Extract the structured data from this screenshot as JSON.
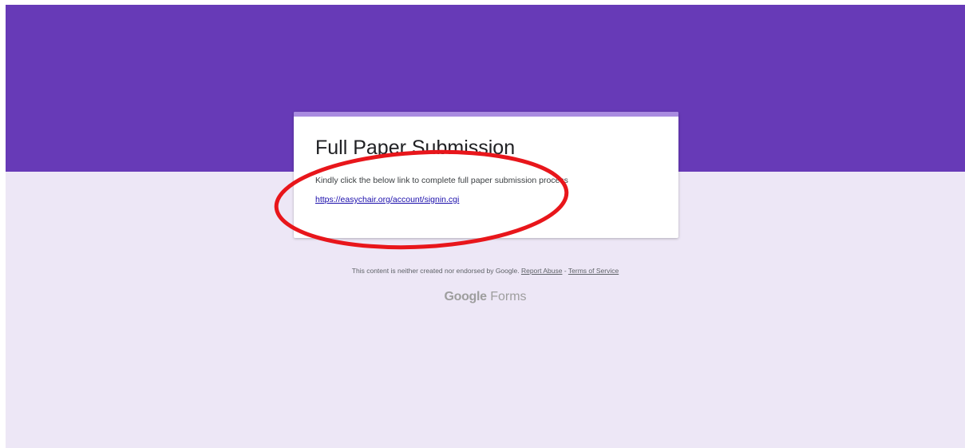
{
  "form": {
    "title": "Full Paper Submission",
    "description": "Kindly click the below link to complete full paper submission process",
    "link_text": "https://easychair.org/account/signin.cgi"
  },
  "footer": {
    "disclaimer": "This content is neither created nor endorsed by Google.",
    "report_abuse": "Report Abuse",
    "separator": " - ",
    "terms": "Terms of Service"
  },
  "brand": {
    "google": "Google",
    "product": "Forms"
  },
  "colors": {
    "header": "#673ab7",
    "background": "#ede7f6",
    "card_accent": "#a98be0",
    "annotation_ellipse": "#e8161b"
  }
}
